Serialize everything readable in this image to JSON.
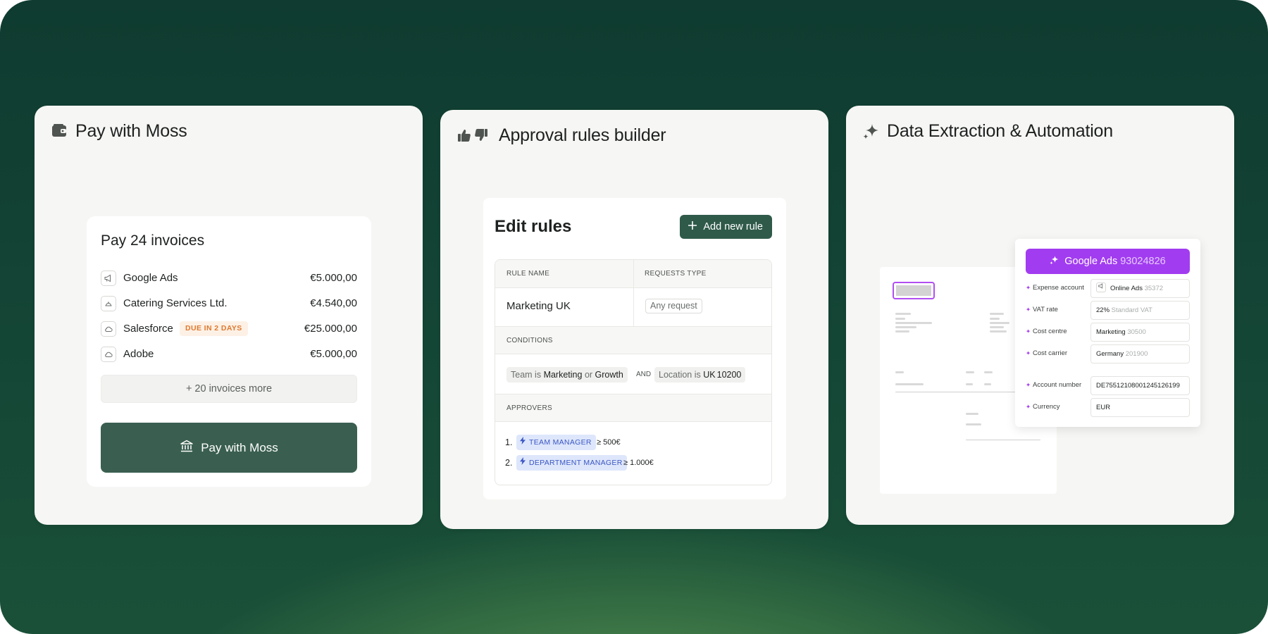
{
  "colors": {
    "accent_green": "#3a5f50",
    "accent_purple": "#a23cf0",
    "due_orange": "#e0782e",
    "approver_blue": "#3c57c4"
  },
  "card1": {
    "title": "Pay with Moss",
    "icon": "wallet-icon",
    "panel": {
      "heading": "Pay 24 invoices",
      "invoices": [
        {
          "name": "Google Ads",
          "amount": "€5.000,00",
          "icon": "megaphone-icon"
        },
        {
          "name": "Catering Services Ltd.",
          "amount": "€4.540,00",
          "icon": "cloche-icon"
        },
        {
          "name": "Salesforce",
          "amount": "€25.000,00",
          "icon": "cloud-icon",
          "badge": "DUE IN 2 DAYS"
        },
        {
          "name": "Adobe",
          "amount": "€5.000,00",
          "icon": "cloud-icon"
        }
      ],
      "more_label": "+ 20 invoices more",
      "pay_button": "Pay with Moss",
      "pay_button_icon": "bank-icon"
    }
  },
  "card2": {
    "title": "Approval rules builder",
    "icons": [
      "thumbs-up-icon",
      "thumbs-down-icon"
    ],
    "panel": {
      "heading": "Edit rules",
      "add_button": "Add new rule",
      "table": {
        "col_rule_name": "RULE NAME",
        "col_requests_type": "REQUESTS TYPE",
        "rule_name": "Marketing UK",
        "requests_type": "Any request",
        "conditions_label": "CONDITIONS",
        "condition1": {
          "field": "Team is",
          "value1": "Marketing",
          "join": "or",
          "value2": "Growth"
        },
        "and_label": "AND",
        "condition2": {
          "field": "Location is",
          "value": "UK",
          "code": "10200"
        },
        "approvers_label": "APPROVERS",
        "approvers": [
          {
            "num": "1.",
            "role": "TEAM MANAGER",
            "condition": "≥ 500€"
          },
          {
            "num": "2.",
            "role": "DEPARTMENT MANAGER",
            "condition": "≥ 1.000€"
          }
        ]
      }
    }
  },
  "card3": {
    "title": "Data Extraction & Automation",
    "icon": "sparkle-icon",
    "panel": {
      "header_name": "Google Ads",
      "header_number": "93024826",
      "rows": [
        {
          "label": "Expense account",
          "value": "Online Ads",
          "muted": "35372",
          "has_icon": true
        },
        {
          "label": "VAT rate",
          "value": "22%",
          "muted": "Standard VAT"
        },
        {
          "label": "Cost centre",
          "value": "Marketing",
          "muted": "30500"
        },
        {
          "label": "Cost carrier",
          "value": "Germany",
          "muted": "201900"
        },
        {
          "label": "Account number",
          "value": "DE75512108001245126199",
          "muted": ""
        },
        {
          "label": "Currency",
          "value": "EUR",
          "muted": ""
        }
      ]
    }
  }
}
